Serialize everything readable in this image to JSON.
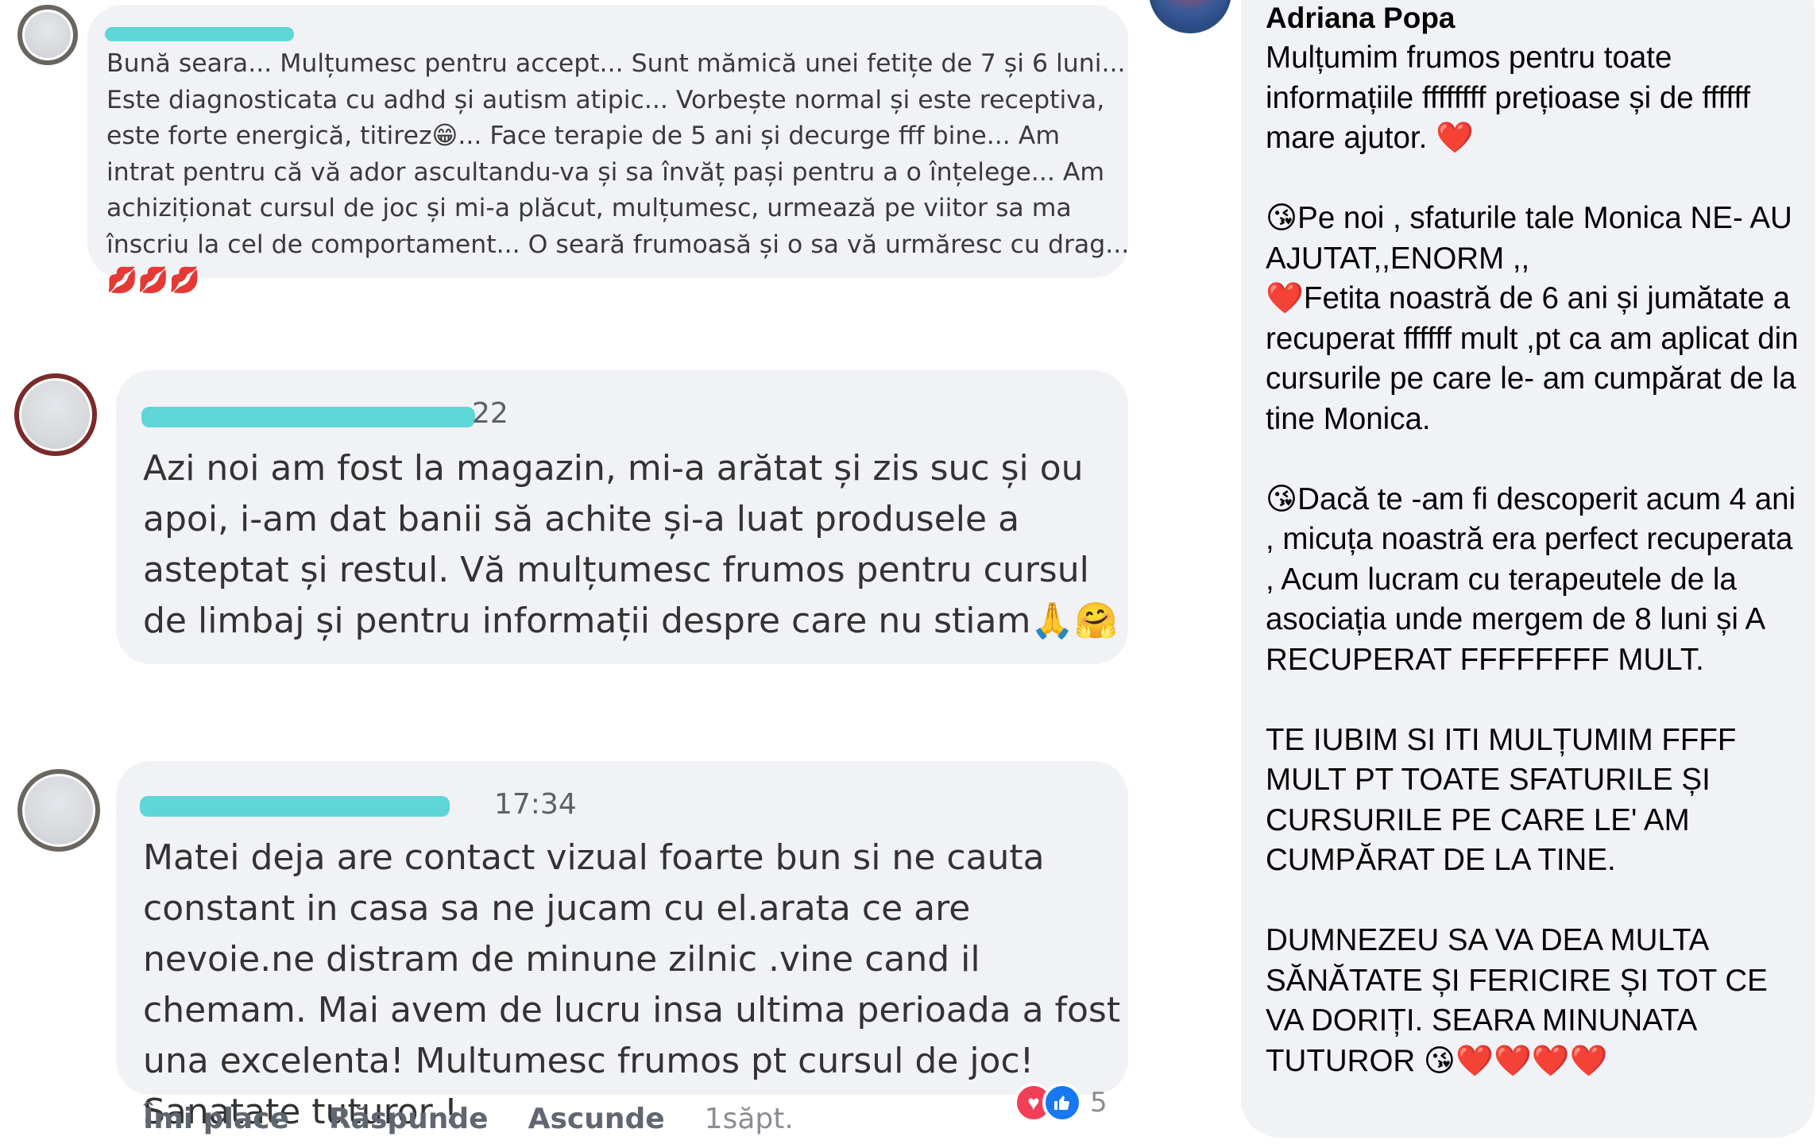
{
  "comments": [
    {
      "author": "",
      "time": "",
      "text": "Bună seara... Mulțumesc pentru accept... Sunt mămică unei fetițe de 7 și 6 luni... Este diagnosticata cu adhd și autism atipic... Vorbește normal și este receptiva, este forte energică, titirez😁... Face terapie de 5 ani și decurge fff bine... Am intrat pentru că vă ador ascultandu-va și sa învăț pași pentru a o înțelege... Am achiziționat cursul de joc și mi-a plăcut, mulțumesc, urmează pe viitor sa ma înscriu la cel de comportament... O seară frumoasă și o sa vă urmăresc cu drag... 💋💋💋"
    },
    {
      "author": "",
      "time": "22",
      "text": "Azi noi am fost la magazin, mi-a arătat și zis suc și ou apoi, i-am dat banii să achite și-a luat produsele a asteptat și restul. Vă mulțumesc frumos pentru cursul de limbaj și pentru informații despre care nu stiam🙏🤗"
    },
    {
      "author": "",
      "time": "17:34",
      "text": "Matei deja are contact vizual foarte bun si ne cauta constant in casa sa ne jucam cu el.arata ce are nevoie.ne distram de minune zilnic .vine cand il chemam. Mai avem de lucru insa ultima perioada a fost una excelenta! Multumesc frumos pt cursul de joc! Sanatate tuturor !"
    }
  ],
  "actions": {
    "like": "Îmi place",
    "reply": "Răspunde",
    "hide": "Ascunde",
    "time": "1săpt."
  },
  "reactions": {
    "icons": [
      "heart-icon",
      "thumbs-up-icon"
    ],
    "count": "5"
  },
  "right_comment": {
    "author": "Adriana Popa",
    "text": "Mulțumim frumos pentru toate informațiile ffffffff prețioase și de ffffff mare ajutor. ❤️\n\n😘Pe noi , sfaturile tale Monica NE- AU AJUTAT,,ENORM ,,\n❤️Fetita noastră de 6 ani și jumătate a recuperat ffffff mult ,pt ca am aplicat din cursurile pe care le- am cumpărat de la tine Monica.\n\n😘Dacă te -am fi descoperit acum 4 ani , micuța noastră era perfect recuperata , Acum lucram cu terapeutele de la asociația unde mergem de 8 luni și A RECUPERAT FFFFFFFF MULT.\n\nTE IUBIM SI ITI MULȚUMIM FFFF MULT PT TOATE SFATURILE ȘI CURSURILE PE CARE LE' AM CUMPĂRAT DE LA TINE.\n\nDUMNEZEU SA VA DEA MULTA SĂNĂTATE ȘI FERICIRE ȘI TOT CE VA DORIȚI. SEARA MINUNATA TUTUROR 😘❤️❤️❤️❤️"
  },
  "colors": {
    "bubble": "#f0f2f5",
    "redaction": "#5fd6d6",
    "love": "#f33e58",
    "like": "#1877f2"
  }
}
